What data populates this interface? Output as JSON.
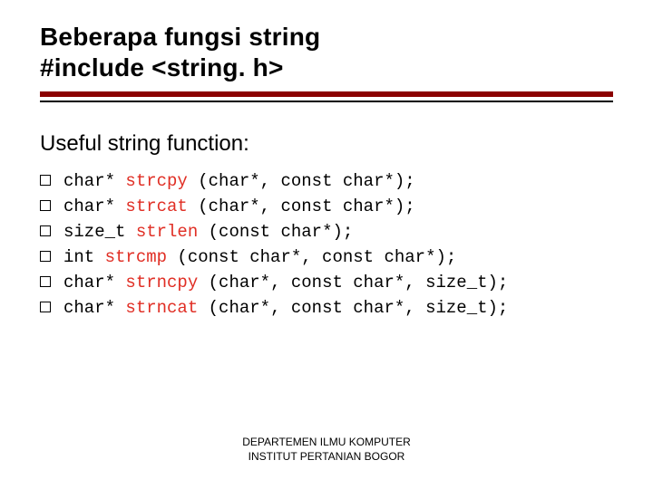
{
  "title": {
    "line1": "Beberapa fungsi string",
    "line2": "#include <string. h>"
  },
  "section_heading": "Useful string function:",
  "functions": [
    {
      "pre": "char* ",
      "name": "strcpy",
      "post": " (char*, const char*);"
    },
    {
      "pre": "char* ",
      "name": "strcat",
      "post": " (char*, const char*);"
    },
    {
      "pre": "size_t ",
      "name": "strlen",
      "post": " (const char*);"
    },
    {
      "pre": "int ",
      "name": "strcmp",
      "post": " (const char*, const char*);"
    },
    {
      "pre": "char* ",
      "name": "strncpy",
      "post": " (char*, const char*, size_t);"
    },
    {
      "pre": "char* ",
      "name": "strncat",
      "post": " (char*, const char*, size_t);"
    }
  ],
  "footer": {
    "line1": "DEPARTEMEN ILMU KOMPUTER",
    "line2": "INSTITUT PERTANIAN BOGOR"
  },
  "colors": {
    "accent_rule": "#8B0000",
    "fn_name": "#E02E24"
  }
}
